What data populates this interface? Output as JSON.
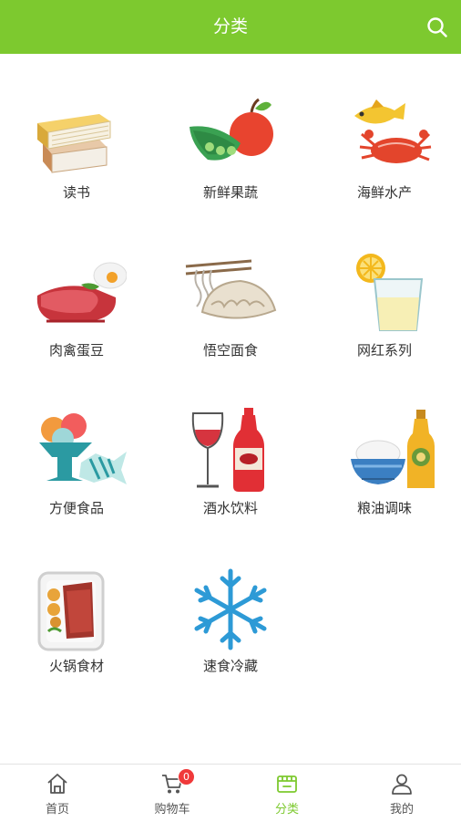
{
  "header": {
    "title": "分类",
    "search_icon": "search-icon"
  },
  "categories": [
    {
      "label": "读书",
      "icon": "books-icon"
    },
    {
      "label": "新鲜果蔬",
      "icon": "fruit-vegetable-icon"
    },
    {
      "label": "海鲜水产",
      "icon": "seafood-icon"
    },
    {
      "label": "肉禽蛋豆",
      "icon": "meat-egg-icon"
    },
    {
      "label": "悟空面食",
      "icon": "noodle-dumpling-icon"
    },
    {
      "label": "网红系列",
      "icon": "lemon-drink-icon"
    },
    {
      "label": "方便食品",
      "icon": "icecream-candy-icon"
    },
    {
      "label": "酒水饮料",
      "icon": "wine-cola-icon"
    },
    {
      "label": "粮油调味",
      "icon": "rice-oil-icon"
    },
    {
      "label": "火锅食材",
      "icon": "hotpot-tray-icon"
    },
    {
      "label": "速食冷藏",
      "icon": "snowflake-icon"
    }
  ],
  "tabbar": {
    "items": [
      {
        "label": "首页",
        "icon": "home-icon"
      },
      {
        "label": "购物车",
        "icon": "cart-icon",
        "badge": "0"
      },
      {
        "label": "分类",
        "icon": "category-icon",
        "active": true
      },
      {
        "label": "我的",
        "icon": "user-icon"
      }
    ]
  },
  "colors": {
    "accent": "#7dc92f",
    "badge": "#f0393a"
  }
}
